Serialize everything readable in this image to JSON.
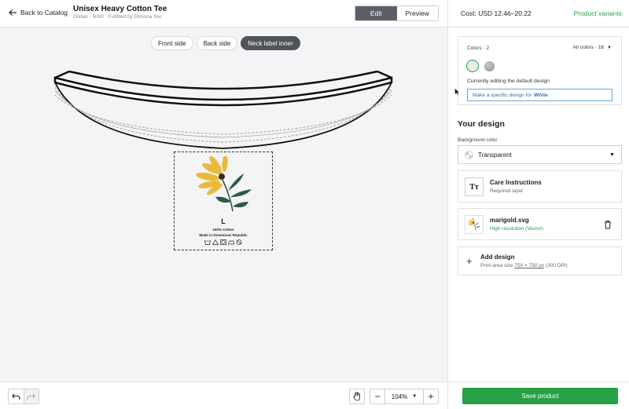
{
  "header": {
    "back_label": "Back to Catalog",
    "product_title": "Unisex Heavy Cotton Tee",
    "product_subtitle": "Gildan · 5000 · Fulfilled by Dimona Tee",
    "edit_label": "Edit",
    "preview_label": "Preview"
  },
  "canvas": {
    "tabs": [
      {
        "label": "Front side",
        "active": false
      },
      {
        "label": "Back side",
        "active": false
      },
      {
        "label": "Neck label inner",
        "active": true
      }
    ],
    "label": {
      "size": "L",
      "material": "100% Cotton",
      "origin": "Made in Dominican Republic",
      "care_icons": [
        "wash-icon",
        "bleach-icon",
        "tumble-dry-icon",
        "iron-icon",
        "dry-clean-icon"
      ]
    }
  },
  "toolbar": {
    "zoom": "104%",
    "undo_icon": "undo-icon",
    "redo_icon": "redo-icon",
    "hand_icon": "hand-icon"
  },
  "panel": {
    "cost": "Cost: USD 12.46–20.22",
    "variants_link": "Product variants",
    "colors_label": "Colors · 2",
    "all_colors": "All colors · 16",
    "editing_text": "Currently editing the default design",
    "specific_prefix": "Make a specific design for",
    "specific_color": "White",
    "your_design": "Your design",
    "bg_label": "Background color",
    "bg_value": "Transparent",
    "layers": [
      {
        "title": "Care Instructions",
        "subtitle": "Required layer"
      },
      {
        "title": "marigold.svg",
        "subtitle": "High resolution (Vector)"
      }
    ],
    "add_title": "Add design",
    "add_sub_prefix": "Print area size",
    "add_sub_size": "750 × 750 px",
    "add_sub_suffix": "(300 DPI)",
    "save_label": "Save product"
  },
  "colors": {
    "accent_green": "#27a046",
    "edit_dark": "#5a6066",
    "link_blue": "#3174b3"
  }
}
